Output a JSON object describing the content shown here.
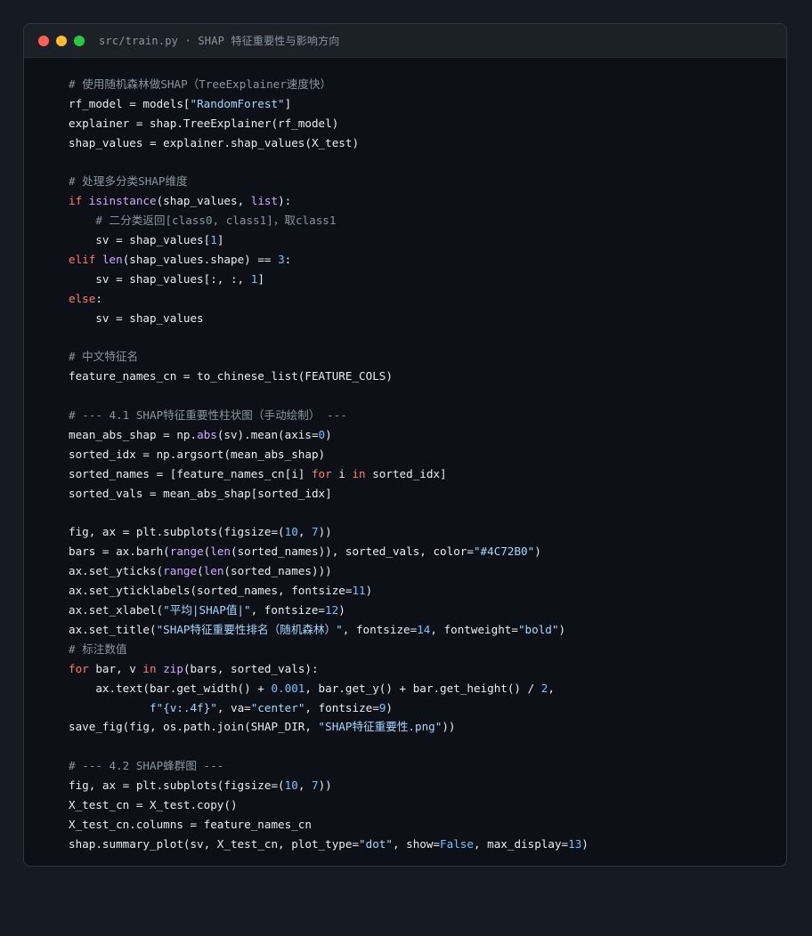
{
  "window": {
    "title": "src/train.py · SHAP 特征重要性与影响方向",
    "colors": {
      "close": "#ff5f57",
      "minimize": "#febc2e",
      "maximize": "#28c840",
      "background": "#0d1117",
      "titlebar": "#1c2128",
      "comment": "#8b949e",
      "keyword": "#ff7b72",
      "builtin": "#d2a8ff",
      "string": "#a5d6ff",
      "number": "#79c0ff",
      "text": "#e6edf3"
    }
  },
  "code": {
    "language": "python",
    "lines": [
      [
        [
          "c",
          "# 使用随机森林做SHAP（TreeExplainer速度快）"
        ]
      ],
      [
        [
          "p",
          "rf_model = models["
        ],
        [
          "s",
          "\"RandomForest\""
        ],
        [
          "p",
          "]"
        ]
      ],
      [
        [
          "p",
          "explainer = shap.TreeExplainer(rf_model)"
        ]
      ],
      [
        [
          "p",
          "shap_values = explainer.shap_values(X_test)"
        ]
      ],
      [],
      [
        [
          "c",
          "# 处理多分类SHAP维度"
        ]
      ],
      [
        [
          "k",
          "if"
        ],
        [
          "p",
          " "
        ],
        [
          "b",
          "isinstance"
        ],
        [
          "p",
          "(shap_values, "
        ],
        [
          "b",
          "list"
        ],
        [
          "p",
          "):"
        ]
      ],
      [
        [
          "p",
          "    "
        ],
        [
          "c",
          "# 二分类返回[class0, class1]，取class1"
        ]
      ],
      [
        [
          "p",
          "    sv = shap_values["
        ],
        [
          "n",
          "1"
        ],
        [
          "p",
          "]"
        ]
      ],
      [
        [
          "k",
          "elif"
        ],
        [
          "p",
          " "
        ],
        [
          "b",
          "len"
        ],
        [
          "p",
          "(shap_values.shape) == "
        ],
        [
          "n",
          "3"
        ],
        [
          "p",
          ":"
        ]
      ],
      [
        [
          "p",
          "    sv = shap_values[:, :, "
        ],
        [
          "n",
          "1"
        ],
        [
          "p",
          "]"
        ]
      ],
      [
        [
          "k",
          "else"
        ],
        [
          "p",
          ":"
        ]
      ],
      [
        [
          "p",
          "    sv = shap_values"
        ]
      ],
      [],
      [
        [
          "c",
          "# 中文特征名"
        ]
      ],
      [
        [
          "p",
          "feature_names_cn = to_chinese_list(FEATURE_COLS)"
        ]
      ],
      [],
      [
        [
          "c",
          "# --- 4.1 SHAP特征重要性柱状图（手动绘制） ---"
        ]
      ],
      [
        [
          "p",
          "mean_abs_shap = np."
        ],
        [
          "b",
          "abs"
        ],
        [
          "p",
          "(sv).mean(axis="
        ],
        [
          "n",
          "0"
        ],
        [
          "p",
          ")"
        ]
      ],
      [
        [
          "p",
          "sorted_idx = np.argsort(mean_abs_shap)"
        ]
      ],
      [
        [
          "p",
          "sorted_names = [feature_names_cn[i] "
        ],
        [
          "k",
          "for"
        ],
        [
          "p",
          " i "
        ],
        [
          "k",
          "in"
        ],
        [
          "p",
          " sorted_idx]"
        ]
      ],
      [
        [
          "p",
          "sorted_vals = mean_abs_shap[sorted_idx]"
        ]
      ],
      [],
      [
        [
          "p",
          "fig, ax = plt.subplots(figsize=("
        ],
        [
          "n",
          "10"
        ],
        [
          "p",
          ", "
        ],
        [
          "n",
          "7"
        ],
        [
          "p",
          "))"
        ]
      ],
      [
        [
          "p",
          "bars = ax.barh("
        ],
        [
          "b",
          "range"
        ],
        [
          "p",
          "("
        ],
        [
          "b",
          "len"
        ],
        [
          "p",
          "(sorted_names)), sorted_vals, color="
        ],
        [
          "s",
          "\"#4C72B0\""
        ],
        [
          "p",
          ")"
        ]
      ],
      [
        [
          "p",
          "ax.set_yticks("
        ],
        [
          "b",
          "range"
        ],
        [
          "p",
          "("
        ],
        [
          "b",
          "len"
        ],
        [
          "p",
          "(sorted_names)))"
        ]
      ],
      [
        [
          "p",
          "ax.set_yticklabels(sorted_names, fontsize="
        ],
        [
          "n",
          "11"
        ],
        [
          "p",
          ")"
        ]
      ],
      [
        [
          "p",
          "ax.set_xlabel("
        ],
        [
          "s",
          "\"平均|SHAP值|\""
        ],
        [
          "p",
          ", fontsize="
        ],
        [
          "n",
          "12"
        ],
        [
          "p",
          ")"
        ]
      ],
      [
        [
          "p",
          "ax.set_title("
        ],
        [
          "s",
          "\"SHAP特征重要性排名（随机森林）\""
        ],
        [
          "p",
          ", fontsize="
        ],
        [
          "n",
          "14"
        ],
        [
          "p",
          ", fontweight="
        ],
        [
          "s",
          "\"bold\""
        ],
        [
          "p",
          ")"
        ]
      ],
      [
        [
          "c",
          "# 标注数值"
        ]
      ],
      [
        [
          "k",
          "for"
        ],
        [
          "p",
          " bar, v "
        ],
        [
          "k",
          "in"
        ],
        [
          "p",
          " "
        ],
        [
          "b",
          "zip"
        ],
        [
          "p",
          "(bars, sorted_vals):"
        ]
      ],
      [
        [
          "p",
          "    ax.text(bar.get_width() + "
        ],
        [
          "n",
          "0.001"
        ],
        [
          "p",
          ", bar.get_y() + bar.get_height() / "
        ],
        [
          "n",
          "2"
        ],
        [
          "p",
          ","
        ]
      ],
      [
        [
          "p",
          "            "
        ],
        [
          "s",
          "f\"{v:.4f}\""
        ],
        [
          "p",
          ", va="
        ],
        [
          "s",
          "\"center\""
        ],
        [
          "p",
          ", fontsize="
        ],
        [
          "n",
          "9"
        ],
        [
          "p",
          ")"
        ]
      ],
      [
        [
          "p",
          "save_fig(fig, os.path.join(SHAP_DIR, "
        ],
        [
          "s",
          "\"SHAP特征重要性.png\""
        ],
        [
          "p",
          "))"
        ]
      ],
      [],
      [
        [
          "c",
          "# --- 4.2 SHAP蜂群图 ---"
        ]
      ],
      [
        [
          "p",
          "fig, ax = plt.subplots(figsize=("
        ],
        [
          "n",
          "10"
        ],
        [
          "p",
          ", "
        ],
        [
          "n",
          "7"
        ],
        [
          "p",
          "))"
        ]
      ],
      [
        [
          "p",
          "X_test_cn = X_test.copy()"
        ]
      ],
      [
        [
          "p",
          "X_test_cn.columns = feature_names_cn"
        ]
      ],
      [
        [
          "p",
          "shap.summary_plot(sv, X_test_cn, plot_type="
        ],
        [
          "s",
          "\"dot\""
        ],
        [
          "p",
          ", show="
        ],
        [
          "n",
          "False"
        ],
        [
          "p",
          ", max_display="
        ],
        [
          "n",
          "13"
        ],
        [
          "p",
          ")"
        ]
      ]
    ]
  }
}
